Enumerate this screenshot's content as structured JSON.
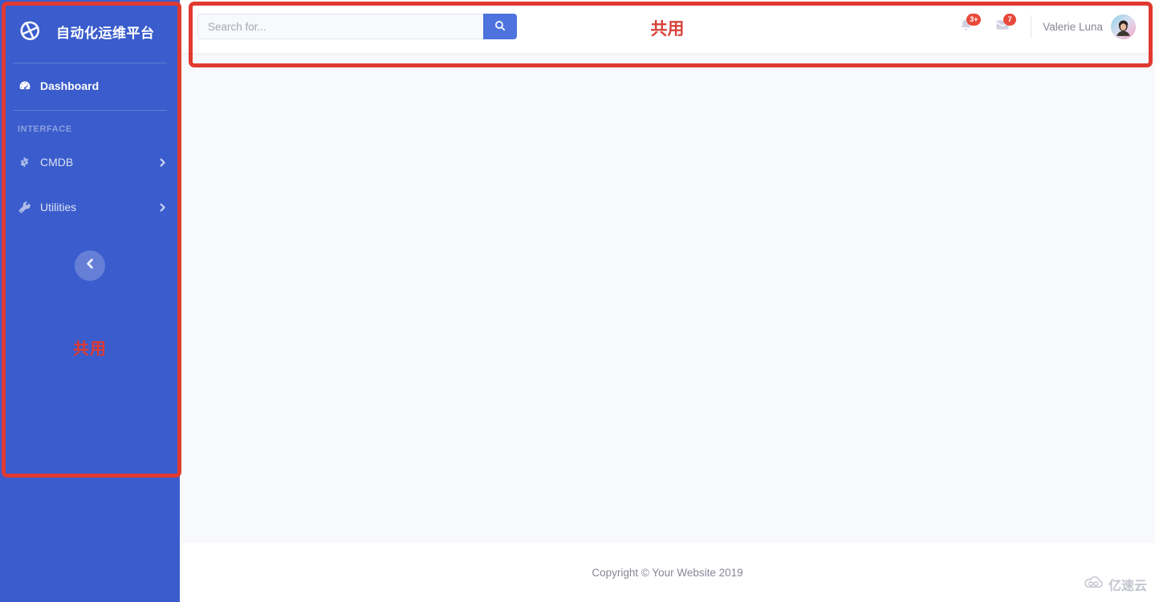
{
  "sidebar": {
    "brand": {
      "text": "自动化运维平台",
      "logo_icon": "cube-logo-icon"
    },
    "primary": [
      {
        "label": "Dashboard",
        "icon": "tachometer-icon",
        "active": true,
        "caret": false
      }
    ],
    "heading": "INTERFACE",
    "items": [
      {
        "label": "CMDB",
        "icon": "gear-icon",
        "active": false,
        "caret": true
      },
      {
        "label": "Utilities",
        "icon": "wrench-icon",
        "active": false,
        "caret": true
      }
    ],
    "toggle_icon": "chevron-left-icon",
    "annotation": "共用",
    "bg_color": "#3a5ccc"
  },
  "topbar": {
    "search": {
      "placeholder": "Search for...",
      "value": "",
      "button_icon": "search-icon"
    },
    "annotation": "共用",
    "notifications": {
      "icon": "bell-icon",
      "badge": "3+"
    },
    "messages": {
      "icon": "envelope-icon",
      "badge": "7"
    },
    "user": {
      "name": "Valerie Luna",
      "avatar_icon": "user-avatar"
    },
    "badge_color": "#e74a3b",
    "accent_color": "#4e73df"
  },
  "footer": {
    "copyright": "Copyright © Your Website 2019"
  },
  "watermark": {
    "text": "亿速云",
    "icon": "cloud-icon"
  },
  "annotation_color": "#e03a30"
}
